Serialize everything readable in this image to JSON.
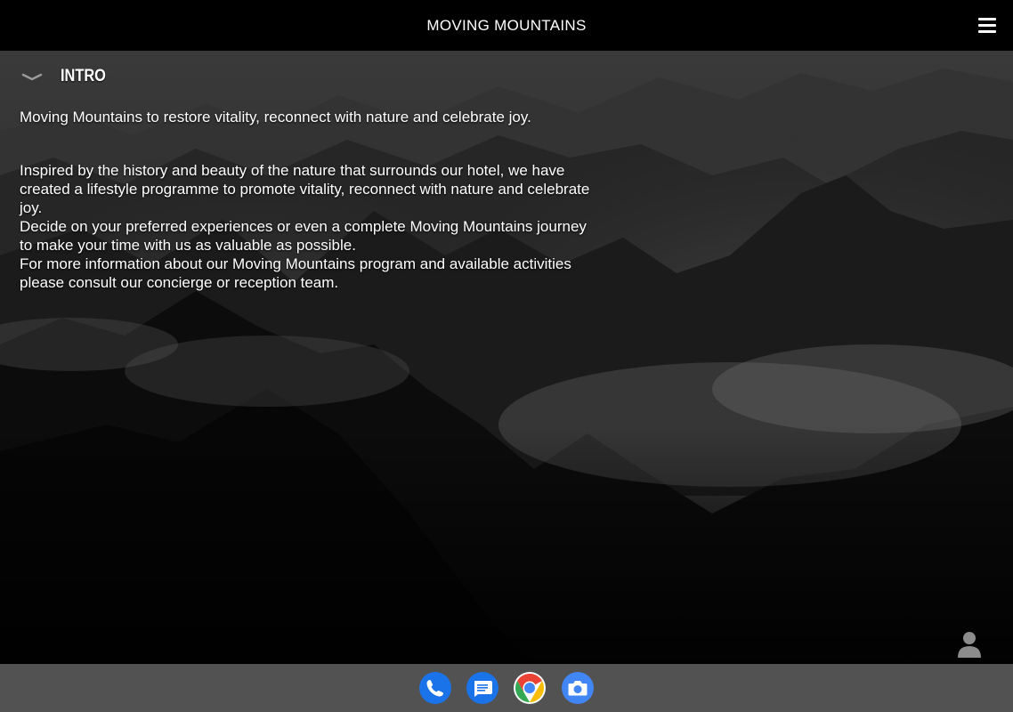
{
  "header": {
    "title": "MOVING MOUNTAINS",
    "menu_icon": "hamburger-menu-icon"
  },
  "section": {
    "title": "INTRO",
    "toggle_icon": "chevron-down-icon",
    "expanded": true
  },
  "content": {
    "lead": "Moving Mountains to restore vitality, reconnect with nature and celebrate joy.",
    "paragraphs": [
      "Inspired by the history and beauty of the nature that surrounds our hotel, we have created a lifestyle programme to promote vitality, reconnect with nature and celebrate joy.",
      "Decide on your preferred experiences or even a complete Moving Mountains journey to make your time with us as valuable as possible.",
      "For more information about our Moving Mountains program and available activities please consult our concierge or reception team."
    ]
  },
  "profile": {
    "icon": "person-icon"
  },
  "dock": {
    "apps": [
      {
        "name": "Phone",
        "icon": "phone-icon",
        "color": "#1a73e8"
      },
      {
        "name": "Messages",
        "icon": "messages-icon",
        "color": "#1a73e8"
      },
      {
        "name": "Chrome",
        "icon": "chrome-icon",
        "color": "#ea4335"
      },
      {
        "name": "Camera",
        "icon": "camera-icon",
        "color": "#4285f4"
      }
    ]
  },
  "colors": {
    "topbar": "#000000",
    "dock": "#525252",
    "text": "#ffffff"
  }
}
